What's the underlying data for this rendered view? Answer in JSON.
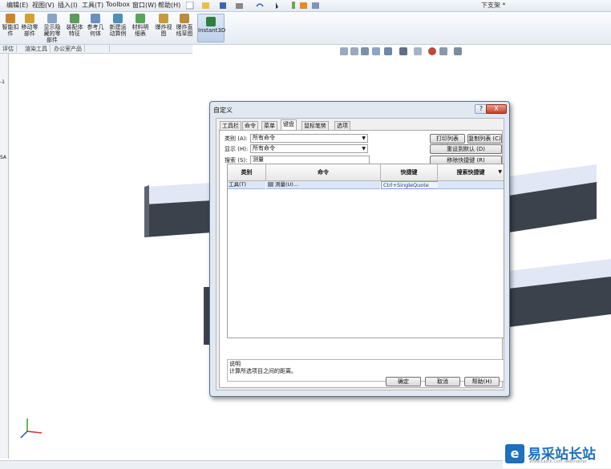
{
  "menubar": {
    "items": [
      "编辑(E)",
      "视图(V)",
      "插入(I)",
      "工具(T)",
      "Toolbox",
      "窗口(W)",
      "帮助(H)"
    ],
    "document_title": "下支架 *"
  },
  "ribbon": {
    "buttons": [
      {
        "label": "智能扣件",
        "icon": "smart-fastener-icon"
      },
      {
        "label": "移动零部件",
        "icon": "move-component-icon"
      },
      {
        "label": "显示隐藏的零部件",
        "icon": "show-hidden-icon"
      },
      {
        "label": "装配体特征",
        "icon": "assembly-feature-icon"
      },
      {
        "label": "参考几何体",
        "icon": "reference-geometry-icon"
      },
      {
        "label": "新建运动算例",
        "icon": "motion-study-icon"
      },
      {
        "label": "材料明细表",
        "icon": "bom-icon"
      },
      {
        "label": "爆炸视图",
        "icon": "explode-view-icon"
      },
      {
        "label": "爆炸直线草图",
        "icon": "explode-line-icon"
      },
      {
        "label": "Instant3D",
        "icon": "instant3d-icon"
      }
    ]
  },
  "panel_tabs": [
    "评估",
    "渲染工具",
    "办公室产品"
  ],
  "left_strip": {
    "labels": [
      "-1",
      "SA"
    ]
  },
  "dialog": {
    "title": "自定义",
    "help_label": "?",
    "close_label": "X",
    "tabs": [
      "工具栏",
      "命令",
      "菜单",
      "键盘",
      "鼠标笔势",
      "选项"
    ],
    "active_tab": "键盘",
    "category": {
      "label": "类别 (A):",
      "value": "所有命令"
    },
    "show": {
      "label": "显示 (H):",
      "value": "所有命令"
    },
    "search": {
      "label": "搜索 (S):",
      "value": "测量"
    },
    "buttons": {
      "print_list": "打印列表 (P)...",
      "copy_list": "复制列表 (C)",
      "reset_default": "重设到默认 (D)",
      "remove_shortcut": "移除快捷键 (R)"
    },
    "table": {
      "columns": [
        "类别",
        "命令",
        "快捷键",
        "搜索快捷键"
      ],
      "rows": [
        {
          "category": "工具(T)",
          "command": "测量(U)...",
          "shortcut": "Ctrl+SingleQuote",
          "search_shortcut": ""
        }
      ]
    },
    "description": {
      "label": "说明",
      "text": "计算所选项目之间的距离。"
    },
    "footer": {
      "ok": "确定",
      "cancel": "取消",
      "help": "帮助(H)"
    }
  },
  "colors": {
    "accent": "#1f6fbf",
    "selection": "#dbe6f6",
    "bar_dark": "#3c424c",
    "bar_light": "#e2e7f6"
  },
  "watermark": {
    "text": "易采站长站",
    "subtext": "Www.Easck.Com Webmaster",
    "logo_char": "e"
  }
}
